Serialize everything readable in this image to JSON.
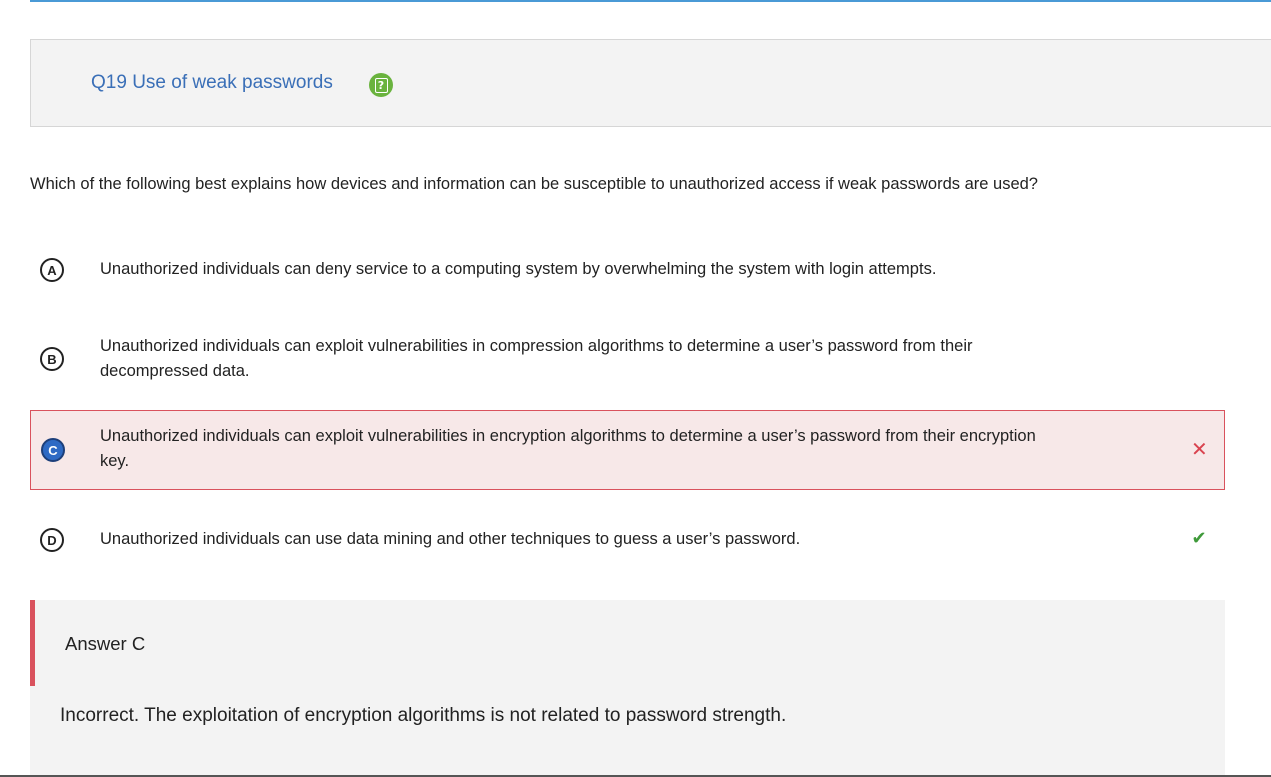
{
  "question": {
    "title": "Q19 Use of weak passwords",
    "help_icon": "question-clipboard-icon",
    "prompt": "Which of the following best explains how devices and information can be susceptible to unauthorized access if weak passwords are used?"
  },
  "choices": [
    {
      "letter": "A",
      "text": "Unauthorized individuals can deny service to a computing system by overwhelming the system with login attempts.",
      "selected": false,
      "mark": ""
    },
    {
      "letter": "B",
      "text": "Unauthorized individuals can exploit vulnerabilities in compression algorithms to determine a user’s password from their decompressed data.",
      "selected": false,
      "mark": ""
    },
    {
      "letter": "C",
      "text": "Unauthorized individuals can exploit vulnerabilities in encryption algorithms to determine a user’s password from their encryption key.",
      "selected": true,
      "mark": "✕"
    },
    {
      "letter": "D",
      "text": "Unauthorized individuals can use data mining and other techniques to guess a user’s password.",
      "selected": false,
      "mark": "✔"
    }
  ],
  "answer": {
    "heading": "Answer C",
    "explanation": "Incorrect. The exploitation of encryption algorithms is not related to password strength."
  },
  "colors": {
    "accent": "#3a6fb7",
    "incorrect": "#d9525d",
    "correct": "#3f9a3a",
    "selected_bg": "#f7e8e8",
    "panel_bg": "#f3f3f3"
  }
}
